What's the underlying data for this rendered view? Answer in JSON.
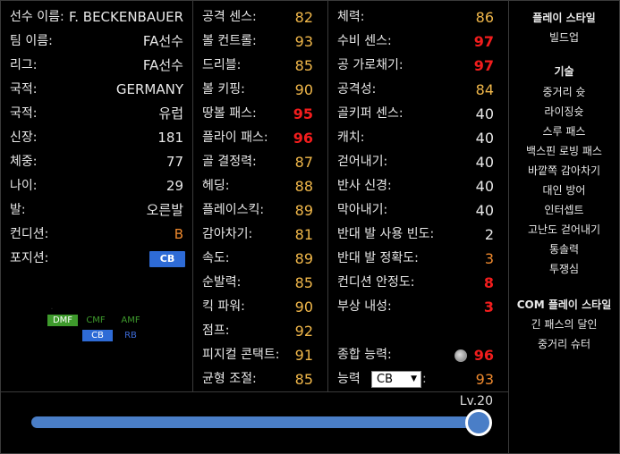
{
  "profile": {
    "rows": [
      {
        "label": "선수 이름:",
        "value": "F. BECKENBAUER"
      },
      {
        "label": "팀 이름:",
        "value": "FA선수"
      },
      {
        "label": "리그:",
        "value": "FA선수"
      },
      {
        "label": "국적:",
        "value": "GERMANY"
      },
      {
        "label": "국적:",
        "value": "유럽"
      },
      {
        "label": "신장:",
        "value": "181"
      },
      {
        "label": "체중:",
        "value": "77"
      },
      {
        "label": "나이:",
        "value": "29"
      },
      {
        "label": "발:",
        "value": "오른발"
      },
      {
        "label": "컨디션:",
        "value": "B"
      },
      {
        "label": "포지션:",
        "value": "CB"
      }
    ],
    "position_map": {
      "dmf": "DMF",
      "cmf": "CMF",
      "amf": "AMF",
      "cb": "CB",
      "rb": "RB"
    }
  },
  "stats_left": [
    {
      "label": "공격 센스:",
      "value": "82"
    },
    {
      "label": "볼 컨트롤:",
      "value": "93"
    },
    {
      "label": "드리블:",
      "value": "85"
    },
    {
      "label": "볼 키핑:",
      "value": "90"
    },
    {
      "label": "땅볼 패스:",
      "value": "95"
    },
    {
      "label": "플라이 패스:",
      "value": "96"
    },
    {
      "label": "골 결정력:",
      "value": "87"
    },
    {
      "label": "헤딩:",
      "value": "88"
    },
    {
      "label": "플레이스킥:",
      "value": "89"
    },
    {
      "label": "감아차기:",
      "value": "81"
    },
    {
      "label": "속도:",
      "value": "89"
    },
    {
      "label": "순발력:",
      "value": "85"
    },
    {
      "label": "킥 파워:",
      "value": "90"
    },
    {
      "label": "점프:",
      "value": "92"
    },
    {
      "label": "피지컬 콘택트:",
      "value": "91"
    },
    {
      "label": "균형 조절:",
      "value": "85"
    }
  ],
  "stats_right": [
    {
      "label": "체력:",
      "value": "86"
    },
    {
      "label": "수비 센스:",
      "value": "97"
    },
    {
      "label": "공 가로채기:",
      "value": "97"
    },
    {
      "label": "공격성:",
      "value": "84"
    },
    {
      "label": "골키퍼 센스:",
      "value": "40"
    },
    {
      "label": "캐치:",
      "value": "40"
    },
    {
      "label": "걷어내기:",
      "value": "40"
    },
    {
      "label": "반사 신경:",
      "value": "40"
    },
    {
      "label": "막아내기:",
      "value": "40"
    },
    {
      "label": "반대 발 사용 빈도:",
      "value": "2"
    },
    {
      "label": "반대 발 정확도:",
      "value": "3"
    },
    {
      "label": "컨디션 안정도:",
      "value": "8"
    },
    {
      "label": "부상 내성:",
      "value": "3"
    }
  ],
  "overall": {
    "label": "종합 능력:",
    "value": "96"
  },
  "ability": {
    "label": "능력",
    "selected": "CB",
    "value": "93"
  },
  "sidebar": {
    "play_style_title": "플레이 스타일",
    "play_style": "빌드업",
    "skills_title": "기술",
    "skills": [
      "중거리 슛",
      "라이징슛",
      "스루 패스",
      "백스핀 로빙 패스",
      "바깥쪽 감아차기",
      "대인 방어",
      "인터셉트",
      "고난도 걷어내기",
      "통솔력",
      "투쟁심"
    ],
    "com_title": "COM 플레이 스타일",
    "com_styles": [
      "긴 패스의 달인",
      "중거리 슈터"
    ]
  },
  "level": {
    "label": "Lv.20",
    "fraction": 1.0
  },
  "colors": {
    "panel_border": "#3a3a3a",
    "yellow": "#f0b74a",
    "orange": "#f08a2e",
    "red": "#f21d1d",
    "blue": "#4a7ec7"
  }
}
